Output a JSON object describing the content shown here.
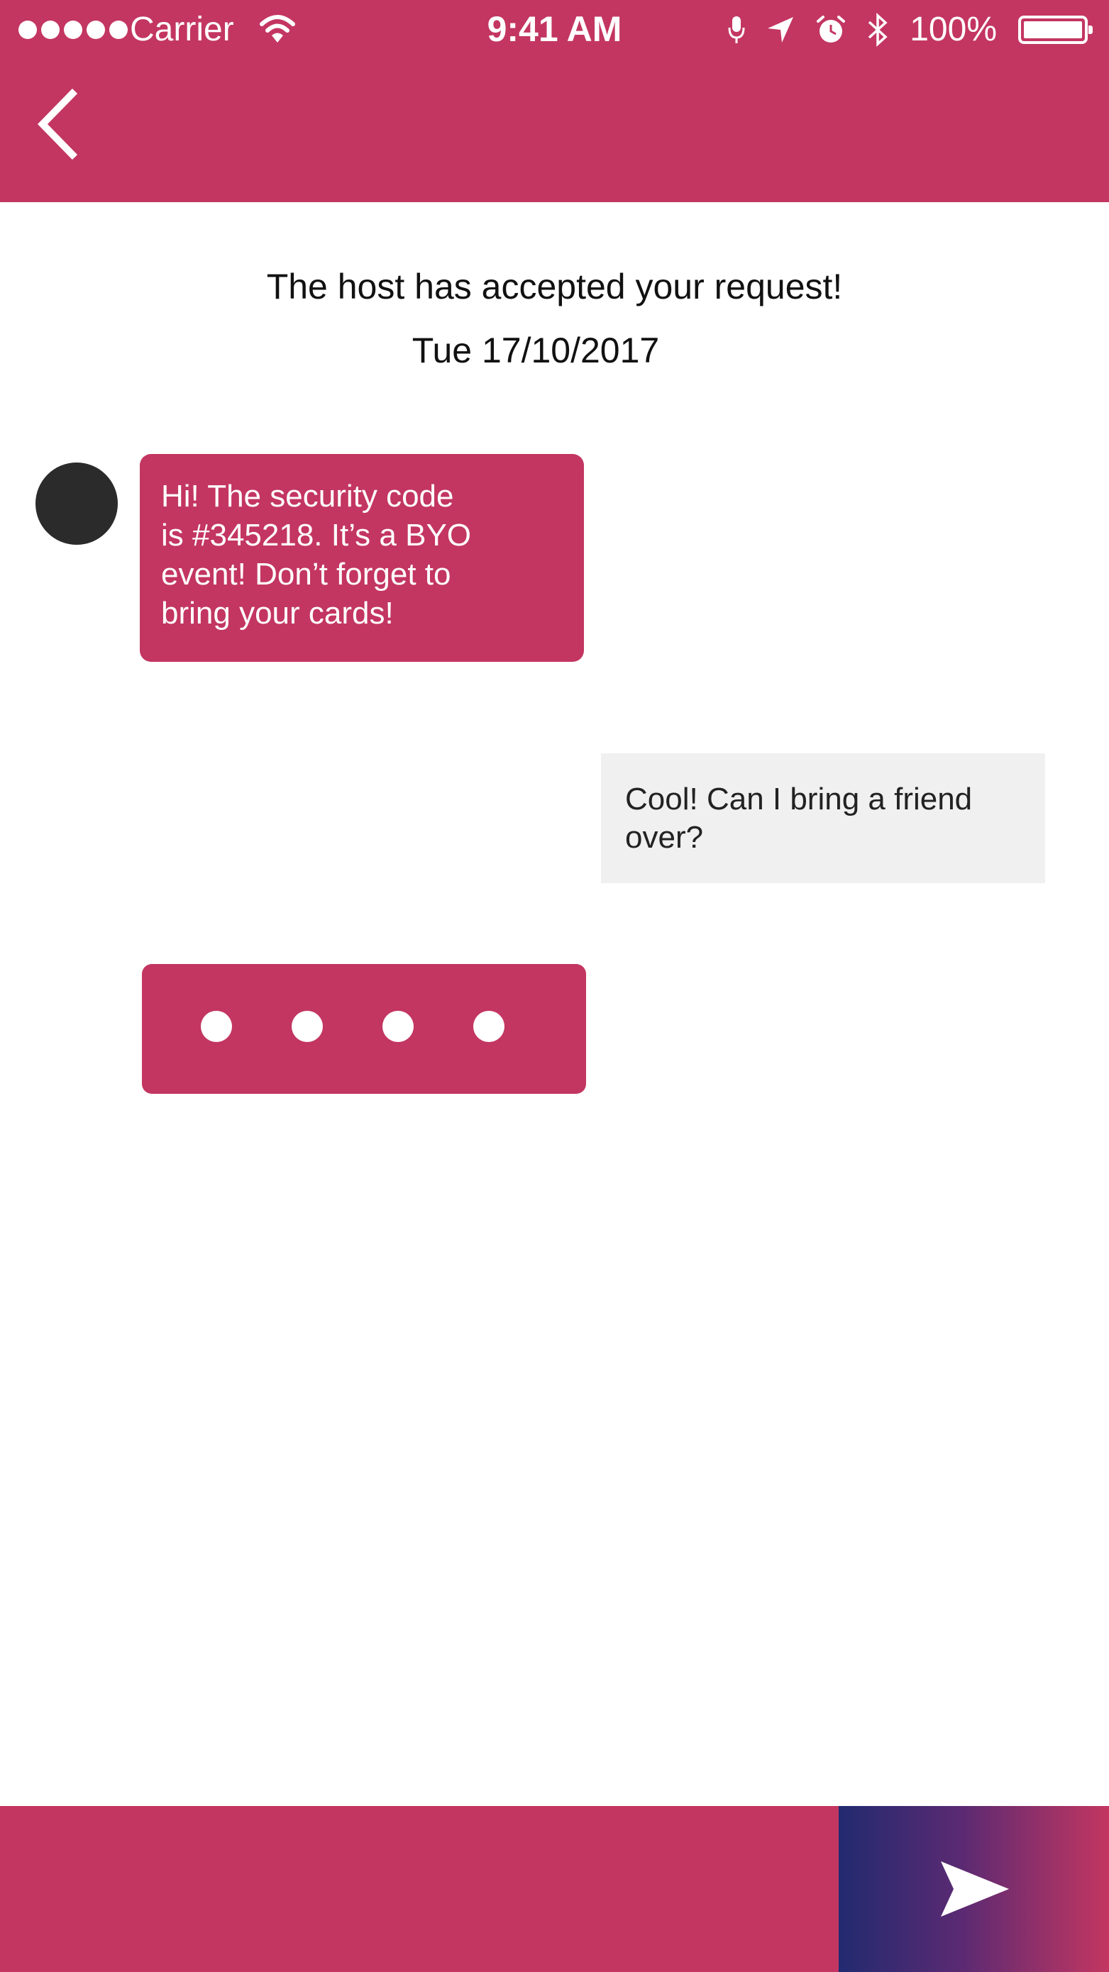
{
  "status_bar": {
    "carrier": "Carrier",
    "time": "9:41 AM",
    "battery_percent": "100%",
    "icons": [
      "signal-dots-icon",
      "wifi-icon",
      "microphone-icon",
      "location-arrow-icon",
      "alarm-icon",
      "bluetooth-icon",
      "battery-icon"
    ],
    "battery_level": 1.0
  },
  "header": {
    "back_icon": "chevron-left-icon"
  },
  "notice": {
    "title": "The host has accepted your request!",
    "date": "Tue 17/10/2017"
  },
  "messages": {
    "incoming_lines": [
      "Hi! The security code",
      "is #345218. It’s a BYO",
      "event! Don’t forget to",
      "bring your cards!"
    ],
    "outgoing_lines": [
      "Cool! Can I bring a friend",
      "over?"
    ],
    "typing_indicator_dots": 4
  },
  "composer": {
    "input_value": "",
    "placeholder": "",
    "send_icon": "send-arrow-icon"
  },
  "colors": {
    "brand": "#c33661",
    "bubble_outgoing": "#f0f0f0",
    "avatar": "#2b2b2b",
    "send_gradient_start": "#222a70",
    "send_gradient_end": "#c33661"
  }
}
